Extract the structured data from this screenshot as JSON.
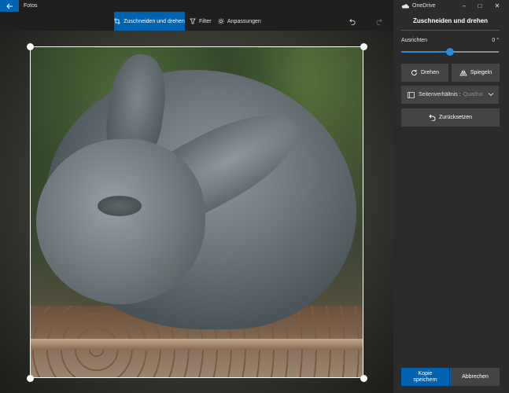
{
  "app": {
    "title": "Fotos",
    "back_icon": "back-arrow-icon"
  },
  "toolbar": {
    "crop_rotate": "Zuschneiden und drehen",
    "filter": "Filter",
    "adjust": "Anpassungen"
  },
  "panel": {
    "window_title": "OneDrive",
    "heading": "Zuschneiden und drehen",
    "straighten_label": "Ausrichten",
    "straighten_value": "0 °",
    "straighten_level": 0.5,
    "rotate_label": "Drehen",
    "flip_label": "Spiegeln",
    "aspect_label": "Seitenverhältnis :",
    "aspect_value": "Quadrat",
    "reset_label": "Zurücksetzen",
    "save_copy_line1": "Kopie",
    "save_copy_line2": "speichern",
    "cancel_label": "Abbrechen"
  },
  "colors": {
    "accent": "#0063b1",
    "panel_bg": "#2b2b2b",
    "button_bg": "#444444"
  }
}
